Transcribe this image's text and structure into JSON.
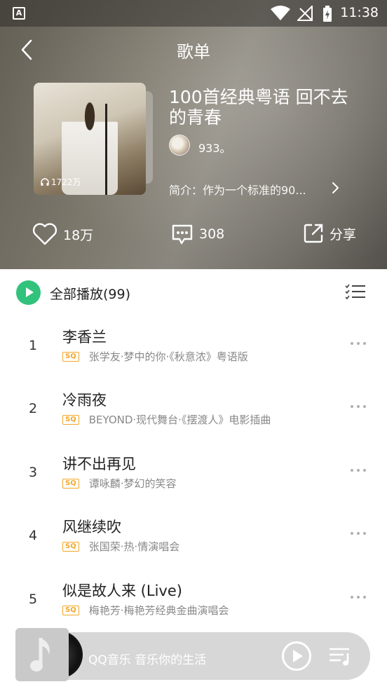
{
  "status_bar": {
    "time": "11:38",
    "app_icon_letter": "A"
  },
  "header": {
    "title": "歌单",
    "back_icon": "chevron-left-icon"
  },
  "playlist": {
    "title": "100首经典粤语 回不去的青春",
    "play_count": "1722万",
    "username": "933。",
    "intro_label": "简介：作为一个标准的90..."
  },
  "actions": {
    "like_count": "18万",
    "comment_count": "308",
    "share_label": "分享"
  },
  "list": {
    "play_all_label": "全部播放(99)",
    "quality_badge": "SQ",
    "songs": [
      {
        "index": "1",
        "name": "李香兰",
        "sub": "张学友·梦中的你·《秋意浓》粤语版"
      },
      {
        "index": "2",
        "name": "冷雨夜",
        "sub": "BEYOND·现代舞台·《摆渡人》电影插曲"
      },
      {
        "index": "3",
        "name": "讲不出再见",
        "sub": "谭咏麟·梦幻的笑容"
      },
      {
        "index": "4",
        "name": "风继续吹",
        "sub": "张国荣·热·情演唱会"
      },
      {
        "index": "5",
        "name": "似是故人来 (Live)",
        "sub": "梅艳芳·梅艳芳经典金曲演唱会"
      }
    ]
  },
  "mini_player": {
    "text": "QQ音乐 音乐你的生活"
  },
  "colors": {
    "accent": "#31c27c",
    "sq_badge": "#f0a72a"
  }
}
